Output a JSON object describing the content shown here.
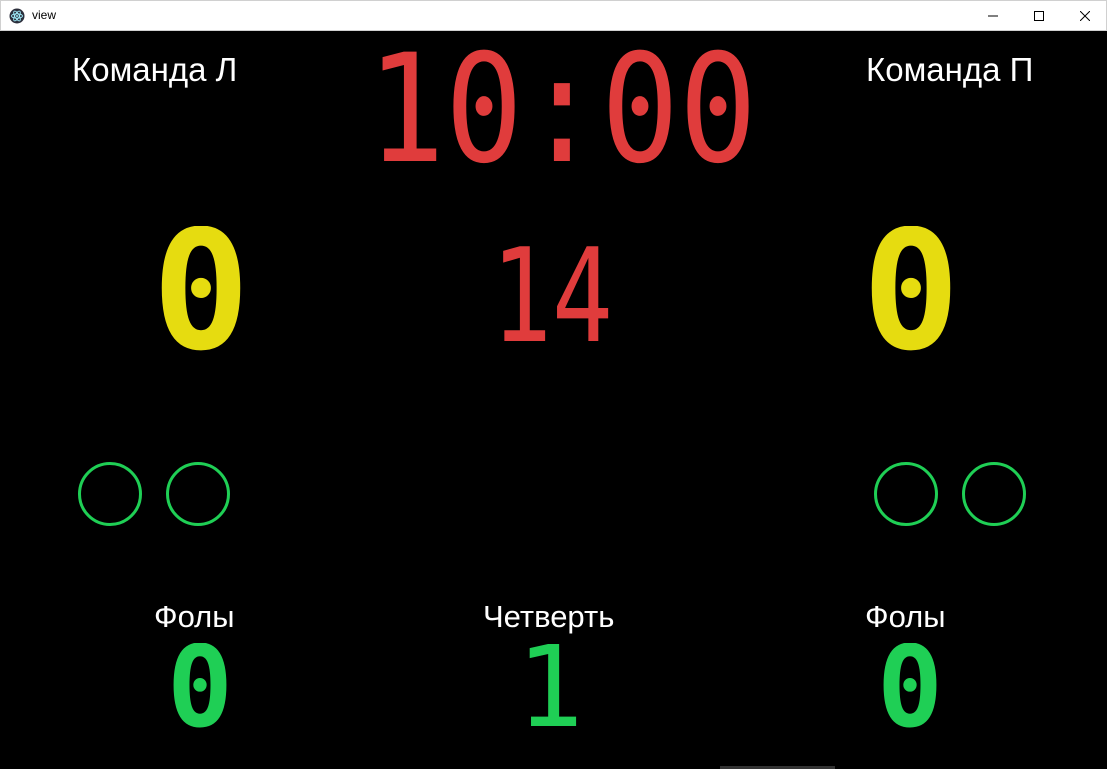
{
  "window": {
    "title": "view",
    "icon": "electron-app-icon",
    "controls": [
      "minimize-icon",
      "maximize-icon",
      "close-icon"
    ]
  },
  "teams": {
    "left": {
      "name": "Команда Л",
      "score": "0",
      "fouls_label": "Фолы",
      "fouls": "0",
      "timeouts": 2
    },
    "right": {
      "name": "Команда П",
      "score": "0",
      "fouls_label": "Фолы",
      "fouls": "0",
      "timeouts": 2
    }
  },
  "clock": {
    "game_time": "10:00",
    "shot_clock": "14"
  },
  "period": {
    "label": "Четверть",
    "value": "1"
  },
  "colors": {
    "background": "#000000",
    "clock": "#e03c3c",
    "score": "#e6dc10",
    "fouls": "#1fcf55",
    "text": "#ffffff"
  }
}
